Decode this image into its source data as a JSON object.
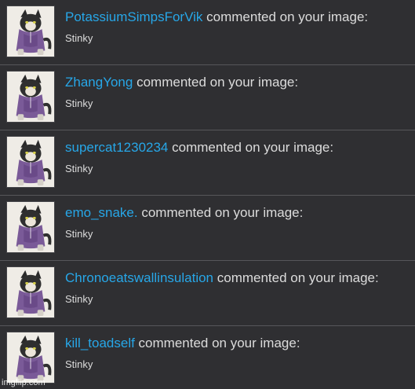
{
  "notifications": [
    {
      "username": "PotassiumSimpsForVik",
      "action_text": " commented on your image:",
      "comment": "Stinky",
      "thumbnail_icon": "cat-in-hoodie-thumbnail"
    },
    {
      "username": "ZhangYong",
      "action_text": " commented on your image:",
      "comment": "Stinky",
      "thumbnail_icon": "cat-in-hoodie-thumbnail"
    },
    {
      "username": "supercat1230234",
      "action_text": " commented on your image:",
      "comment": "Stinky",
      "thumbnail_icon": "cat-in-hoodie-thumbnail"
    },
    {
      "username": "emo_snake.",
      "action_text": " commented on your image:",
      "comment": "Stinky",
      "thumbnail_icon": "cat-in-hoodie-thumbnail"
    },
    {
      "username": "Chronoeatswallinsulation",
      "action_text": " commented on your image:",
      "comment": "Stinky",
      "thumbnail_icon": "cat-in-hoodie-thumbnail"
    },
    {
      "username": "kill_toadself",
      "action_text": " commented on your image:",
      "comment": "Stinky",
      "thumbnail_icon": "cat-in-hoodie-thumbnail"
    }
  ],
  "watermark": "imgflip.com",
  "colors": {
    "background": "#2f2f32",
    "username": "#27a7e8",
    "text": "#dcdcdc",
    "divider": "#56565a"
  }
}
